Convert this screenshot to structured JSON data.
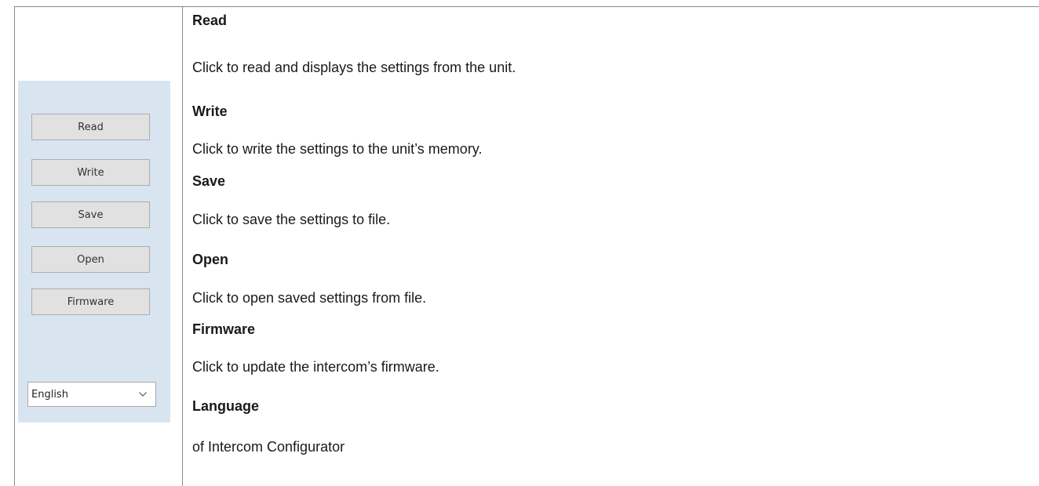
{
  "panel": {
    "buttons": {
      "read": "Read",
      "write": "Write",
      "save": "Save",
      "open": "Open",
      "firmware": "Firmware"
    },
    "language_select": {
      "value": "English",
      "icon": "chevron-down-icon"
    },
    "colors": {
      "background": "#d9e4f1",
      "button": "#e1e1e1"
    }
  },
  "descriptions": [
    {
      "term": "Read",
      "text": "Click to read and displays the settings from the unit."
    },
    {
      "term": "Write",
      "text": "Click to write the settings to the unit’s memory."
    },
    {
      "term": "Save",
      "text": "Click to save the settings to file."
    },
    {
      "term": "Open",
      "text": "Click to open saved settings from file."
    },
    {
      "term": "Firmware",
      "text": "Click to update the intercom’s firmware."
    },
    {
      "term": "Language",
      "text": "of Intercom Configurator"
    }
  ]
}
